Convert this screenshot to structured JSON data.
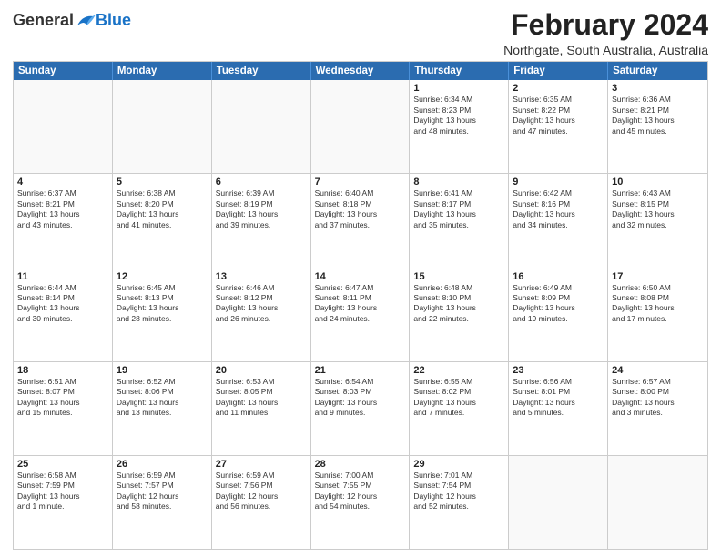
{
  "logo": {
    "general": "General",
    "blue": "Blue"
  },
  "title": "February 2024",
  "subtitle": "Northgate, South Australia, Australia",
  "header_days": [
    "Sunday",
    "Monday",
    "Tuesday",
    "Wednesday",
    "Thursday",
    "Friday",
    "Saturday"
  ],
  "rows": [
    [
      {
        "day": "",
        "info": "",
        "empty": true
      },
      {
        "day": "",
        "info": "",
        "empty": true
      },
      {
        "day": "",
        "info": "",
        "empty": true
      },
      {
        "day": "",
        "info": "",
        "empty": true
      },
      {
        "day": "1",
        "info": "Sunrise: 6:34 AM\nSunset: 8:23 PM\nDaylight: 13 hours\nand 48 minutes."
      },
      {
        "day": "2",
        "info": "Sunrise: 6:35 AM\nSunset: 8:22 PM\nDaylight: 13 hours\nand 47 minutes."
      },
      {
        "day": "3",
        "info": "Sunrise: 6:36 AM\nSunset: 8:21 PM\nDaylight: 13 hours\nand 45 minutes."
      }
    ],
    [
      {
        "day": "4",
        "info": "Sunrise: 6:37 AM\nSunset: 8:21 PM\nDaylight: 13 hours\nand 43 minutes."
      },
      {
        "day": "5",
        "info": "Sunrise: 6:38 AM\nSunset: 8:20 PM\nDaylight: 13 hours\nand 41 minutes."
      },
      {
        "day": "6",
        "info": "Sunrise: 6:39 AM\nSunset: 8:19 PM\nDaylight: 13 hours\nand 39 minutes."
      },
      {
        "day": "7",
        "info": "Sunrise: 6:40 AM\nSunset: 8:18 PM\nDaylight: 13 hours\nand 37 minutes."
      },
      {
        "day": "8",
        "info": "Sunrise: 6:41 AM\nSunset: 8:17 PM\nDaylight: 13 hours\nand 35 minutes."
      },
      {
        "day": "9",
        "info": "Sunrise: 6:42 AM\nSunset: 8:16 PM\nDaylight: 13 hours\nand 34 minutes."
      },
      {
        "day": "10",
        "info": "Sunrise: 6:43 AM\nSunset: 8:15 PM\nDaylight: 13 hours\nand 32 minutes."
      }
    ],
    [
      {
        "day": "11",
        "info": "Sunrise: 6:44 AM\nSunset: 8:14 PM\nDaylight: 13 hours\nand 30 minutes."
      },
      {
        "day": "12",
        "info": "Sunrise: 6:45 AM\nSunset: 8:13 PM\nDaylight: 13 hours\nand 28 minutes."
      },
      {
        "day": "13",
        "info": "Sunrise: 6:46 AM\nSunset: 8:12 PM\nDaylight: 13 hours\nand 26 minutes."
      },
      {
        "day": "14",
        "info": "Sunrise: 6:47 AM\nSunset: 8:11 PM\nDaylight: 13 hours\nand 24 minutes."
      },
      {
        "day": "15",
        "info": "Sunrise: 6:48 AM\nSunset: 8:10 PM\nDaylight: 13 hours\nand 22 minutes."
      },
      {
        "day": "16",
        "info": "Sunrise: 6:49 AM\nSunset: 8:09 PM\nDaylight: 13 hours\nand 19 minutes."
      },
      {
        "day": "17",
        "info": "Sunrise: 6:50 AM\nSunset: 8:08 PM\nDaylight: 13 hours\nand 17 minutes."
      }
    ],
    [
      {
        "day": "18",
        "info": "Sunrise: 6:51 AM\nSunset: 8:07 PM\nDaylight: 13 hours\nand 15 minutes."
      },
      {
        "day": "19",
        "info": "Sunrise: 6:52 AM\nSunset: 8:06 PM\nDaylight: 13 hours\nand 13 minutes."
      },
      {
        "day": "20",
        "info": "Sunrise: 6:53 AM\nSunset: 8:05 PM\nDaylight: 13 hours\nand 11 minutes."
      },
      {
        "day": "21",
        "info": "Sunrise: 6:54 AM\nSunset: 8:03 PM\nDaylight: 13 hours\nand 9 minutes."
      },
      {
        "day": "22",
        "info": "Sunrise: 6:55 AM\nSunset: 8:02 PM\nDaylight: 13 hours\nand 7 minutes."
      },
      {
        "day": "23",
        "info": "Sunrise: 6:56 AM\nSunset: 8:01 PM\nDaylight: 13 hours\nand 5 minutes."
      },
      {
        "day": "24",
        "info": "Sunrise: 6:57 AM\nSunset: 8:00 PM\nDaylight: 13 hours\nand 3 minutes."
      }
    ],
    [
      {
        "day": "25",
        "info": "Sunrise: 6:58 AM\nSunset: 7:59 PM\nDaylight: 13 hours\nand 1 minute."
      },
      {
        "day": "26",
        "info": "Sunrise: 6:59 AM\nSunset: 7:57 PM\nDaylight: 12 hours\nand 58 minutes."
      },
      {
        "day": "27",
        "info": "Sunrise: 6:59 AM\nSunset: 7:56 PM\nDaylight: 12 hours\nand 56 minutes."
      },
      {
        "day": "28",
        "info": "Sunrise: 7:00 AM\nSunset: 7:55 PM\nDaylight: 12 hours\nand 54 minutes."
      },
      {
        "day": "29",
        "info": "Sunrise: 7:01 AM\nSunset: 7:54 PM\nDaylight: 12 hours\nand 52 minutes."
      },
      {
        "day": "",
        "info": "",
        "empty": true
      },
      {
        "day": "",
        "info": "",
        "empty": true
      }
    ]
  ]
}
